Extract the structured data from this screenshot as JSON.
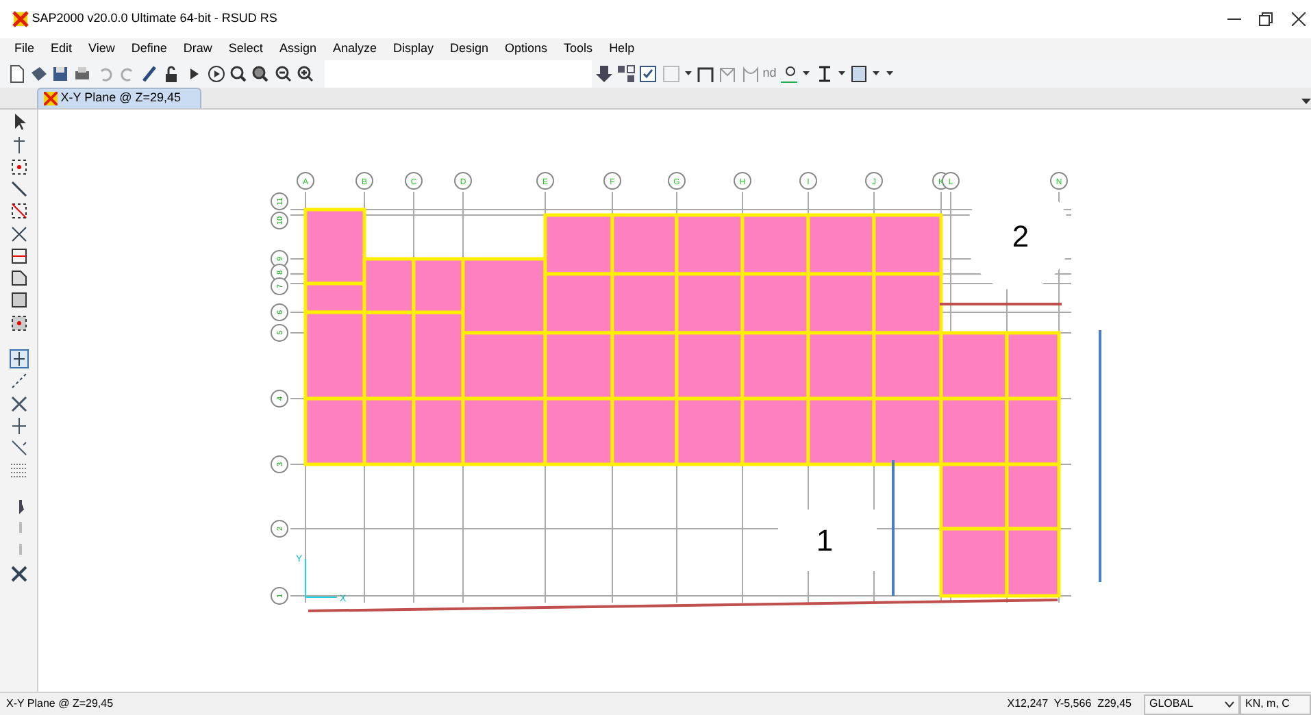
{
  "window": {
    "title": "SAP2000 v20.0.0 Ultimate 64-bit - RSUD RS"
  },
  "menu": [
    "File",
    "Edit",
    "View",
    "Define",
    "Draw",
    "Select",
    "Assign",
    "Analyze",
    "Display",
    "Design",
    "Options",
    "Tools",
    "Help"
  ],
  "toolbar": {
    "label": "nd"
  },
  "tabs": [
    {
      "label": "X-Y Plane @ Z=29,45",
      "selected": true
    }
  ],
  "plan": {
    "column_grid": [
      "A",
      "B",
      "C",
      "D",
      "E",
      "F",
      "G",
      "H",
      "I",
      "J",
      "K",
      "L",
      "N"
    ],
    "row_grid": [
      "11",
      "10",
      "9",
      "8",
      "7",
      "6",
      "5",
      "4",
      "3",
      "2",
      "1"
    ],
    "callouts": [
      "2",
      "1"
    ],
    "axis_labels": [
      "Y",
      "X"
    ]
  },
  "status_bar": {
    "view": "X-Y Plane @ Z=29,45",
    "coordinates": "X12,247  Y-5,566  Z29,45",
    "coordinate_system": "GLOBAL",
    "units": "KN, m, C"
  }
}
